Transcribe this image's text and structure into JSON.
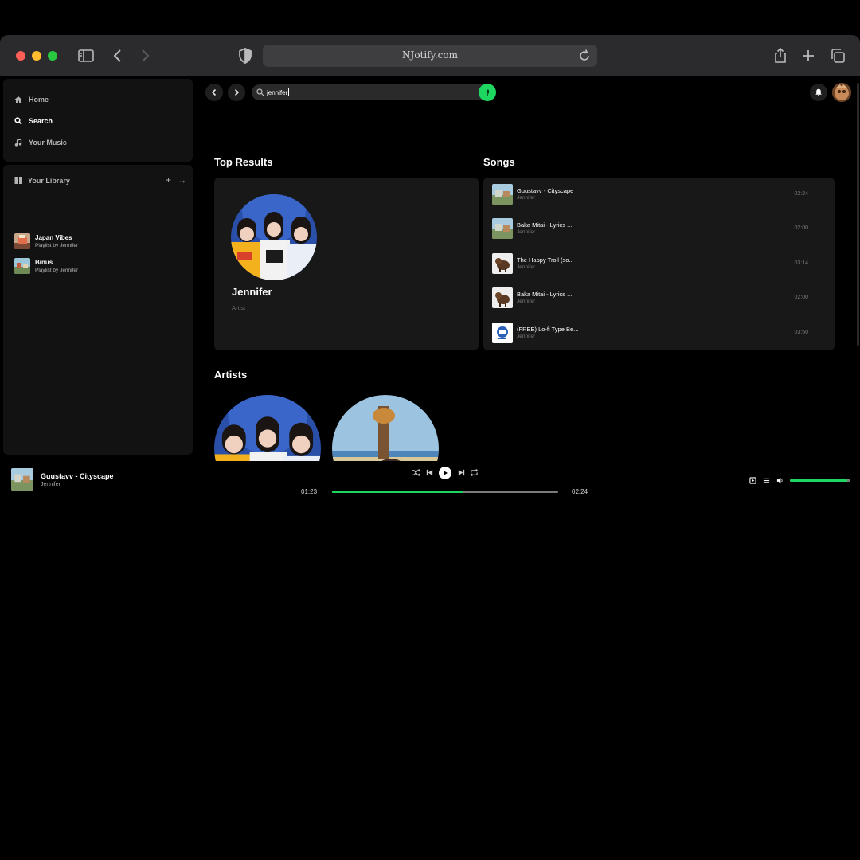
{
  "browser": {
    "url": "NJotify.com"
  },
  "sidebar": {
    "nav": [
      {
        "label": "Home",
        "icon": "home-icon"
      },
      {
        "label": "Search",
        "icon": "search-icon"
      },
      {
        "label": "Your Music",
        "icon": "music-note-icon"
      }
    ],
    "library": {
      "title": "Your Library",
      "playlists": [
        {
          "title": "Japan Vibes",
          "subtitle": "Playlist by Jennifer"
        },
        {
          "title": "Binus",
          "subtitle": "Playlist by Jennifer"
        }
      ]
    }
  },
  "search": {
    "query": "jennifer"
  },
  "sections": {
    "top_results": "Top Results",
    "songs": "Songs",
    "artists": "Artists"
  },
  "top_result": {
    "name": "Jennifer",
    "type": "Artist ."
  },
  "songs": [
    {
      "title": "Guustavv - Cityscape",
      "artist": "Jennifer",
      "duration": "02:24"
    },
    {
      "title": "Baka Mitai - Lyrics ...",
      "artist": "Jennifer",
      "duration": "02:00"
    },
    {
      "title": "The Happy Troll (so...",
      "artist": "Jennifer",
      "duration": "03:14"
    },
    {
      "title": "Baka Mitai - Lyrics ...",
      "artist": "Jennifer",
      "duration": "02:00"
    },
    {
      "title": "(FREE) Lo-fi Type Be...",
      "artist": "Jennifer",
      "duration": "03:50"
    }
  ],
  "player": {
    "title": "Guustavv - Cityscape",
    "artist": "Jennifer",
    "current_time": "01:23",
    "total_time": "02:24",
    "progress_fraction": 0.58,
    "volume_fraction": 0.95
  },
  "colors": {
    "accent": "#1ed760",
    "panel": "#121212",
    "card": "#181818"
  }
}
